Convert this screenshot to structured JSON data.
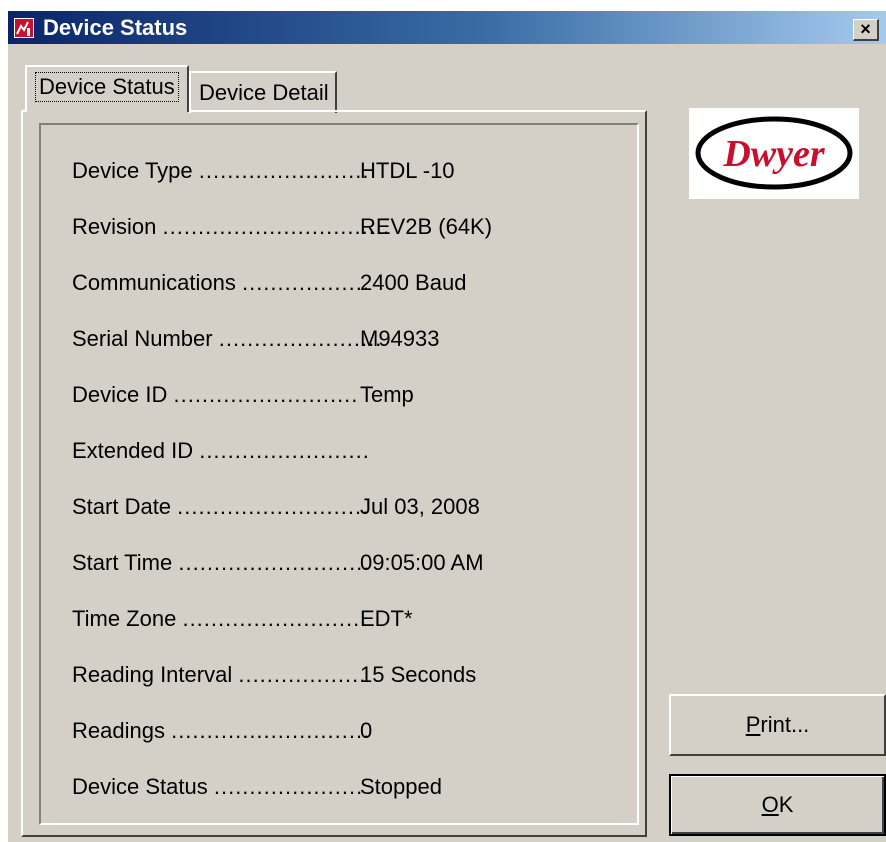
{
  "window": {
    "title": "Device Status",
    "close_label": "×"
  },
  "tabs": [
    {
      "label": "Device Status",
      "active": true
    },
    {
      "label": "Device Detail",
      "active": false
    }
  ],
  "status_rows": [
    {
      "label": "Device Type",
      "dots": "........................",
      "value": "HTDL -10"
    },
    {
      "label": "Revision",
      "dots": "................................",
      "value": "REV2B (64K)"
    },
    {
      "label": "Communications",
      "dots": "..................",
      "value": "2400 Baud"
    },
    {
      "label": "Serial Number",
      "dots": ".......................",
      "value": "M94933"
    },
    {
      "label": "Device ID",
      "dots": "..........................",
      "value": "Temp"
    },
    {
      "label": "Extended ID",
      "dots": "........................",
      "value": ""
    },
    {
      "label": "Start Date",
      "dots": "...........................",
      "value": "Jul 03, 2008"
    },
    {
      "label": "Start Time",
      "dots": "...........................",
      "value": "09:05:00 AM"
    },
    {
      "label": "Time Zone",
      "dots": "..........................",
      "value": "EDT*"
    },
    {
      "label": "Reading Interval",
      "dots": "..................",
      "value": "15 Seconds"
    },
    {
      "label": "Readings",
      "dots": "............................",
      "value": "0"
    },
    {
      "label": "Device Status",
      "dots": ".....................",
      "value": "Stopped"
    }
  ],
  "logo": {
    "text": "Dwyer"
  },
  "buttons": {
    "print": {
      "mnemonic": "P",
      "rest": "rint..."
    },
    "ok": {
      "mnemonic": "O",
      "rest": "K"
    }
  },
  "colors": {
    "titlebar_start": "#0a246a",
    "titlebar_end": "#a6caf0",
    "face": "#d4d0c8",
    "logo_red": "#c8102e"
  }
}
